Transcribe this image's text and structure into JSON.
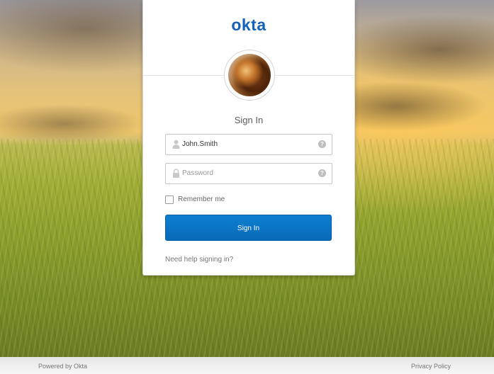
{
  "brand": {
    "logo_text": "okta",
    "color": "#1662b8"
  },
  "form": {
    "title": "Sign In",
    "username": {
      "value": "John.Smith",
      "icon": "user-icon",
      "help_icon": "question-circle-icon"
    },
    "password": {
      "placeholder": "Password",
      "icon": "lock-icon",
      "help_icon": "question-circle-icon"
    },
    "remember_me": {
      "label": "Remember me",
      "checked": false
    },
    "submit_label": "Sign In",
    "submit_color": "#0a72c2",
    "help_link": "Need help signing in?"
  },
  "footer": {
    "powered_by": "Powered by Okta",
    "privacy": "Privacy Policy"
  }
}
